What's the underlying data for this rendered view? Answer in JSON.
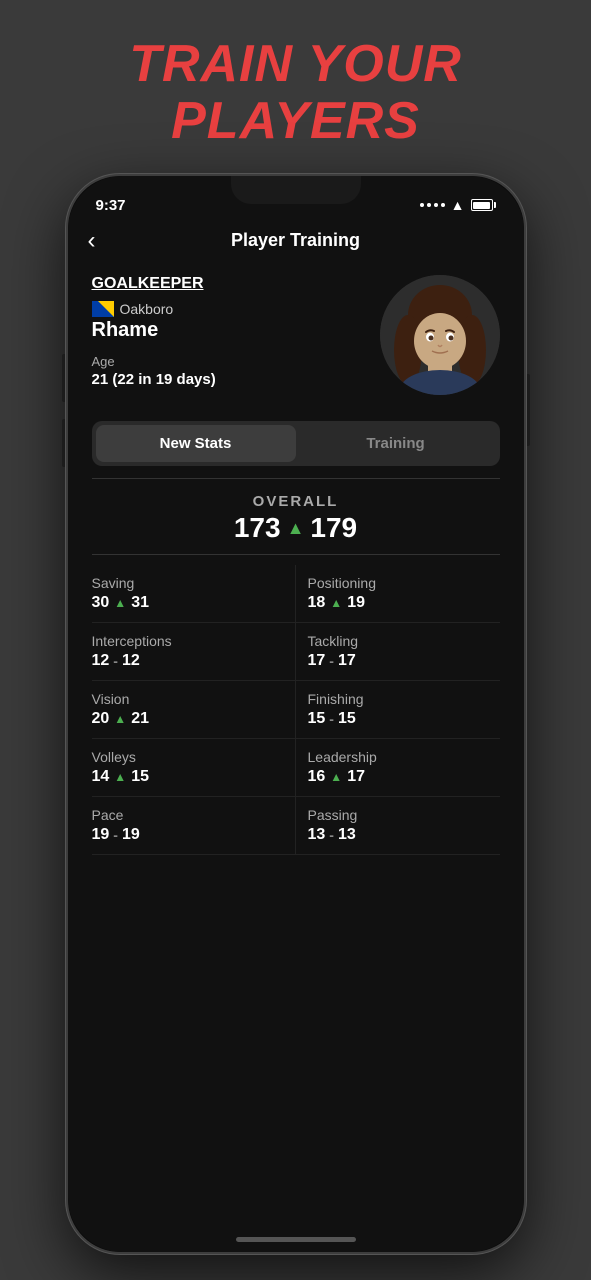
{
  "page": {
    "title_line1": "TRAIN YOUR",
    "title_line2": "PLAYERS"
  },
  "statusBar": {
    "time": "9:37",
    "hasSignal": true,
    "hasWifi": true,
    "hasBattery": true
  },
  "header": {
    "back_label": "‹",
    "title": "Player Training"
  },
  "player": {
    "position": "GOALKEEPER",
    "club": "Oakboro",
    "name": "Rhame",
    "age_label": "Age",
    "age_value": "21 (22 in 19 days)"
  },
  "tabs": {
    "active": "New Stats",
    "inactive": "Training"
  },
  "overall": {
    "label": "OVERALL",
    "old_value": "173",
    "new_value": "179"
  },
  "stats": [
    {
      "name": "Saving",
      "old": "30",
      "new": "31",
      "improved": true
    },
    {
      "name": "Positioning",
      "old": "18",
      "new": "19",
      "improved": true
    },
    {
      "name": "Interceptions",
      "old": "12",
      "new": "12",
      "improved": false
    },
    {
      "name": "Tackling",
      "old": "17",
      "new": "17",
      "improved": false
    },
    {
      "name": "Vision",
      "old": "20",
      "new": "21",
      "improved": true
    },
    {
      "name": "Finishing",
      "old": "15",
      "new": "15",
      "improved": false
    },
    {
      "name": "Volleys",
      "old": "14",
      "new": "15",
      "improved": true
    },
    {
      "name": "Leadership",
      "old": "16",
      "new": "17",
      "improved": true
    },
    {
      "name": "Pace",
      "old": "19",
      "new": "19",
      "improved": false
    },
    {
      "name": "Passing",
      "old": "13",
      "new": "13",
      "improved": false
    }
  ]
}
